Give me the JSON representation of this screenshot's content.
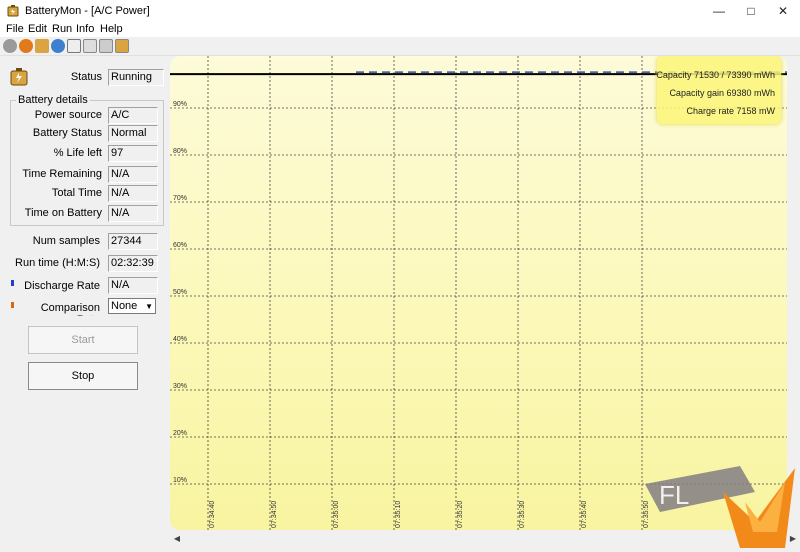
{
  "window": {
    "title": "BatteryMon - [A/C Power]"
  },
  "menu": {
    "items": [
      "File",
      "Edit",
      "Run",
      "Info",
      "Help"
    ]
  },
  "status": {
    "label": "Status",
    "value": "Running"
  },
  "battery_details": {
    "title": "Battery details",
    "power_source": {
      "label": "Power source",
      "value": "A/C"
    },
    "battery_status": {
      "label": "Battery Status",
      "value": "Normal"
    },
    "life_left": {
      "label": "% Life left",
      "value": "97"
    },
    "time_remaining": {
      "label": "Time Remaining",
      "value": "N/A"
    },
    "total_time": {
      "label": "Total Time",
      "value": "N/A"
    },
    "time_on_battery": {
      "label": "Time on Battery",
      "value": "N/A"
    }
  },
  "num_samples": {
    "label": "Num samples",
    "value": "27344"
  },
  "run_time": {
    "label": "Run time (H:M:S)",
    "value": "02:32:39"
  },
  "discharge_rate": {
    "label": "Discharge Rate",
    "value": "N/A",
    "color": "#1f3fcf"
  },
  "comparison_rate": {
    "label": "Comparison Rate",
    "value": "None",
    "color": "#d66a10"
  },
  "buttons": {
    "start": "Start",
    "stop": "Stop"
  },
  "legend": {
    "capacity": "Capacity 71530 / 73390 mWh",
    "capacity_gain": "Capacity gain 69380 mWh",
    "charge_rate": "Charge rate 7158 mW"
  },
  "chart_data": {
    "type": "line",
    "y_ticks": [
      "90%",
      "80%",
      "70%",
      "60%",
      "50%",
      "40%",
      "30%",
      "20%",
      "10%"
    ],
    "x_ticks": [
      "07:34:40",
      "07:34:50",
      "07:35:00",
      "07:35:10",
      "07:35:20",
      "07:35:30",
      "07:35:40",
      "07:35:50"
    ],
    "grid": true,
    "series": [
      {
        "values": [
          97,
          97,
          97,
          97,
          97,
          97,
          97,
          97,
          97
        ]
      },
      {
        "values": [
          97,
          97,
          97,
          97,
          97,
          97,
          97,
          97,
          97
        ]
      }
    ],
    "colors": {
      "capacity_line": "#000000",
      "dashed_line": "#3a4fa0",
      "grid": "#444444"
    }
  },
  "watermark": {
    "text": "FL"
  }
}
